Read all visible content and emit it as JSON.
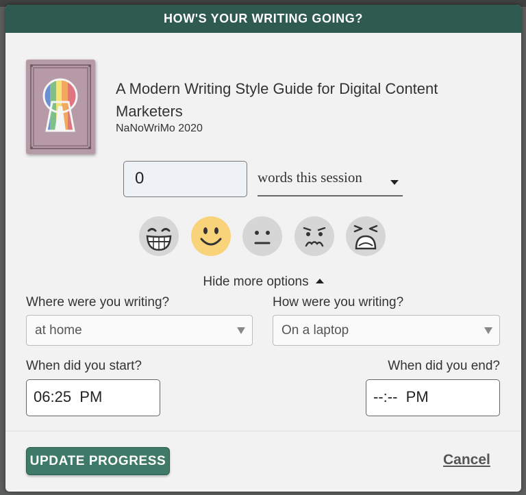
{
  "dialog": {
    "title": "HOW'S YOUR WRITING GOING?"
  },
  "project": {
    "title": "A Modern Writing Style Guide for Digital Content Marketers",
    "event": "NaNoWriMo 2020",
    "cover_icon": "keyhole-rainbow-icon"
  },
  "progress": {
    "count_value": "0",
    "unit_selected": "words this session"
  },
  "moods": [
    {
      "name": "ecstatic-face-icon",
      "selected": false
    },
    {
      "name": "happy-face-icon",
      "selected": true
    },
    {
      "name": "neutral-face-icon",
      "selected": false
    },
    {
      "name": "worried-face-icon",
      "selected": false
    },
    {
      "name": "distressed-face-icon",
      "selected": false
    }
  ],
  "more_options": {
    "toggle_label": "Hide more options"
  },
  "where": {
    "label": "Where were you writing?",
    "selected": "at home"
  },
  "how": {
    "label": "How were you writing?",
    "selected": "On a laptop"
  },
  "start": {
    "label": "When did you start?",
    "value": "06:25  PM"
  },
  "end": {
    "label": "When did you end?",
    "value": "--:--  PM"
  },
  "actions": {
    "update_label": "UPDATE PROGRESS",
    "cancel_label": "Cancel"
  },
  "colors": {
    "header": "#2e5a50",
    "button": "#3f7a69",
    "selected_mood": "#f9d37a",
    "unselected_mood": "#d6d6d6"
  }
}
